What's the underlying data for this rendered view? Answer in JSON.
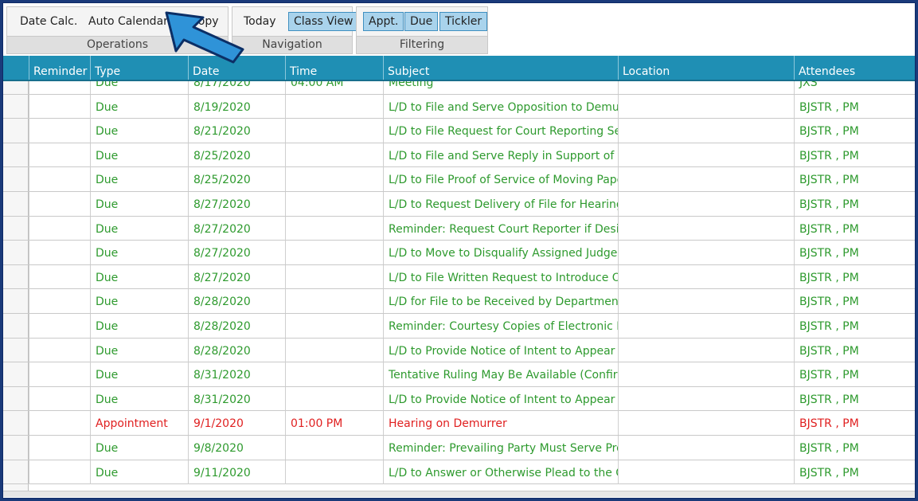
{
  "ribbon": {
    "operations": {
      "buttons": [
        "Date Calc.",
        "Auto Calendar",
        "Copy"
      ],
      "label": "Operations"
    },
    "navigation": {
      "buttons": [
        "Today",
        "Class View"
      ],
      "label": "Navigation"
    },
    "filtering": {
      "buttons": [
        "Appt.",
        "Due",
        "Tickler"
      ],
      "label": "Filtering"
    }
  },
  "grid": {
    "columns": [
      "Reminder",
      "Type",
      "Date",
      "Time",
      "Subject",
      "Location",
      "Attendees"
    ],
    "rows": [
      {
        "reminder": "",
        "type": "Due",
        "date": "8/17/2020",
        "time": "04:00 AM",
        "subject": "Meeting",
        "location": "",
        "attendees": "JXS",
        "kind": "due"
      },
      {
        "reminder": "",
        "type": "Due",
        "date": "8/19/2020",
        "time": "",
        "subject": "L/D to File and Serve Opposition to Demurre",
        "location": "",
        "attendees": "BJSTR , PM",
        "kind": "due"
      },
      {
        "reminder": "",
        "type": "Due",
        "date": "8/21/2020",
        "time": "",
        "subject": "L/D to File Request for Court Reporting Serv",
        "location": "",
        "attendees": "BJSTR , PM",
        "kind": "due"
      },
      {
        "reminder": "",
        "type": "Due",
        "date": "8/25/2020",
        "time": "",
        "subject": "L/D to File and Serve Reply in Support of De",
        "location": "",
        "attendees": "BJSTR , PM",
        "kind": "due"
      },
      {
        "reminder": "",
        "type": "Due",
        "date": "8/25/2020",
        "time": "",
        "subject": "L/D to File Proof of Service of Moving Paper",
        "location": "",
        "attendees": "BJSTR , PM",
        "kind": "due"
      },
      {
        "reminder": "",
        "type": "Due",
        "date": "8/27/2020",
        "time": "",
        "subject": "L/D to Request Delivery of File for Hearing (.",
        "location": "",
        "attendees": "BJSTR , PM",
        "kind": "due"
      },
      {
        "reminder": "",
        "type": "Due",
        "date": "8/27/2020",
        "time": "",
        "subject": "Reminder: Request Court Reporter if Desirec",
        "location": "",
        "attendees": "BJSTR , PM",
        "kind": "due"
      },
      {
        "reminder": "",
        "type": "Due",
        "date": "8/27/2020",
        "time": "",
        "subject": "L/D to Move to Disqualify Assigned Judge ((",
        "location": "",
        "attendees": "BJSTR , PM",
        "kind": "due"
      },
      {
        "reminder": "",
        "type": "Due",
        "date": "8/27/2020",
        "time": "",
        "subject": "L/D to File Written Request to Introduce Ora",
        "location": "",
        "attendees": "BJSTR , PM",
        "kind": "due"
      },
      {
        "reminder": "",
        "type": "Due",
        "date": "8/28/2020",
        "time": "",
        "subject": "L/D for File to be Received by Department ir",
        "location": "",
        "attendees": "BJSTR , PM",
        "kind": "due"
      },
      {
        "reminder": "",
        "type": "Due",
        "date": "8/28/2020",
        "time": "",
        "subject": "Reminder: Courtesy Copies of Electronic Filir",
        "location": "",
        "attendees": "BJSTR , PM",
        "kind": "due"
      },
      {
        "reminder": "",
        "type": "Due",
        "date": "8/28/2020",
        "time": "",
        "subject": "L/D to Provide Notice of Intent to Appear at",
        "location": "",
        "attendees": "BJSTR , PM",
        "kind": "due"
      },
      {
        "reminder": "",
        "type": "Due",
        "date": "8/31/2020",
        "time": "",
        "subject": "Tentative Ruling May Be Available (Confirm I",
        "location": "",
        "attendees": "BJSTR , PM",
        "kind": "due"
      },
      {
        "reminder": "",
        "type": "Due",
        "date": "8/31/2020",
        "time": "",
        "subject": "L/D to Provide Notice of Intent to Appear at",
        "location": "",
        "attendees": "BJSTR , PM",
        "kind": "due"
      },
      {
        "reminder": "",
        "type": "Appointment",
        "date": "9/1/2020",
        "time": "01:00 PM",
        "subject": "Hearing on Demurrer",
        "location": "",
        "attendees": "BJSTR , PM",
        "kind": "appointment"
      },
      {
        "reminder": "",
        "type": "Due",
        "date": "9/8/2020",
        "time": "",
        "subject": "Reminder: Prevailing Party Must Serve Propc",
        "location": "",
        "attendees": "BJSTR , PM",
        "kind": "due"
      },
      {
        "reminder": "",
        "type": "Due",
        "date": "9/11/2020",
        "time": "",
        "subject": "L/D to Answer or Otherwise Plead to the Co",
        "location": "",
        "attendees": "BJSTR , PM",
        "kind": "due"
      }
    ]
  },
  "colors": {
    "due": "#2e9a2e",
    "appointment": "#e02020",
    "header": "#1f8fb4",
    "arrow": "#2f93d8"
  },
  "icons": {
    "callout": "arrow-pointer-icon"
  }
}
